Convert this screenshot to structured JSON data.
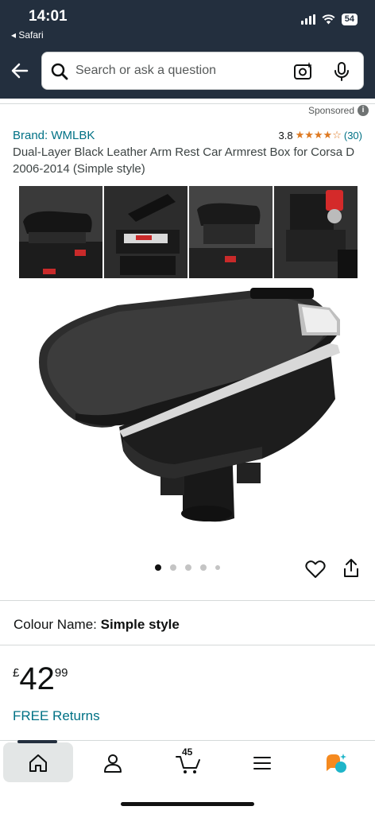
{
  "status_bar": {
    "time": "14:01",
    "back_app": "◂ Safari",
    "battery": "54"
  },
  "header": {
    "search_placeholder": "Search or ask a question"
  },
  "sponsored": {
    "label": "Sponsored",
    "info": "i"
  },
  "product": {
    "brand": "Brand: WMLBK",
    "rating_value": "3.8",
    "stars": "★★★★☆",
    "rating_count": "(30)",
    "title": "Dual-Layer Black Leather Arm Rest Car Armrest Box for Corsa D 2006-2014 (Simple style)",
    "thumbnails": 4,
    "carousel_dots": 5,
    "carousel_active_index": 0
  },
  "colour": {
    "label": "Colour Name:",
    "value": "Simple style"
  },
  "price": {
    "currency": "£",
    "whole": "42",
    "fraction": "99"
  },
  "free_returns": "FREE Returns",
  "bottom_nav": {
    "cart_count": "45",
    "items": [
      "home-icon",
      "account-icon",
      "cart-icon",
      "menu-icon",
      "rufus-icon"
    ]
  },
  "colors": {
    "header_bg": "#232f3e",
    "link": "#007185",
    "star": "#de7921",
    "rufus_orange": "#f58a1f",
    "rufus_teal": "#1fb5c9"
  }
}
